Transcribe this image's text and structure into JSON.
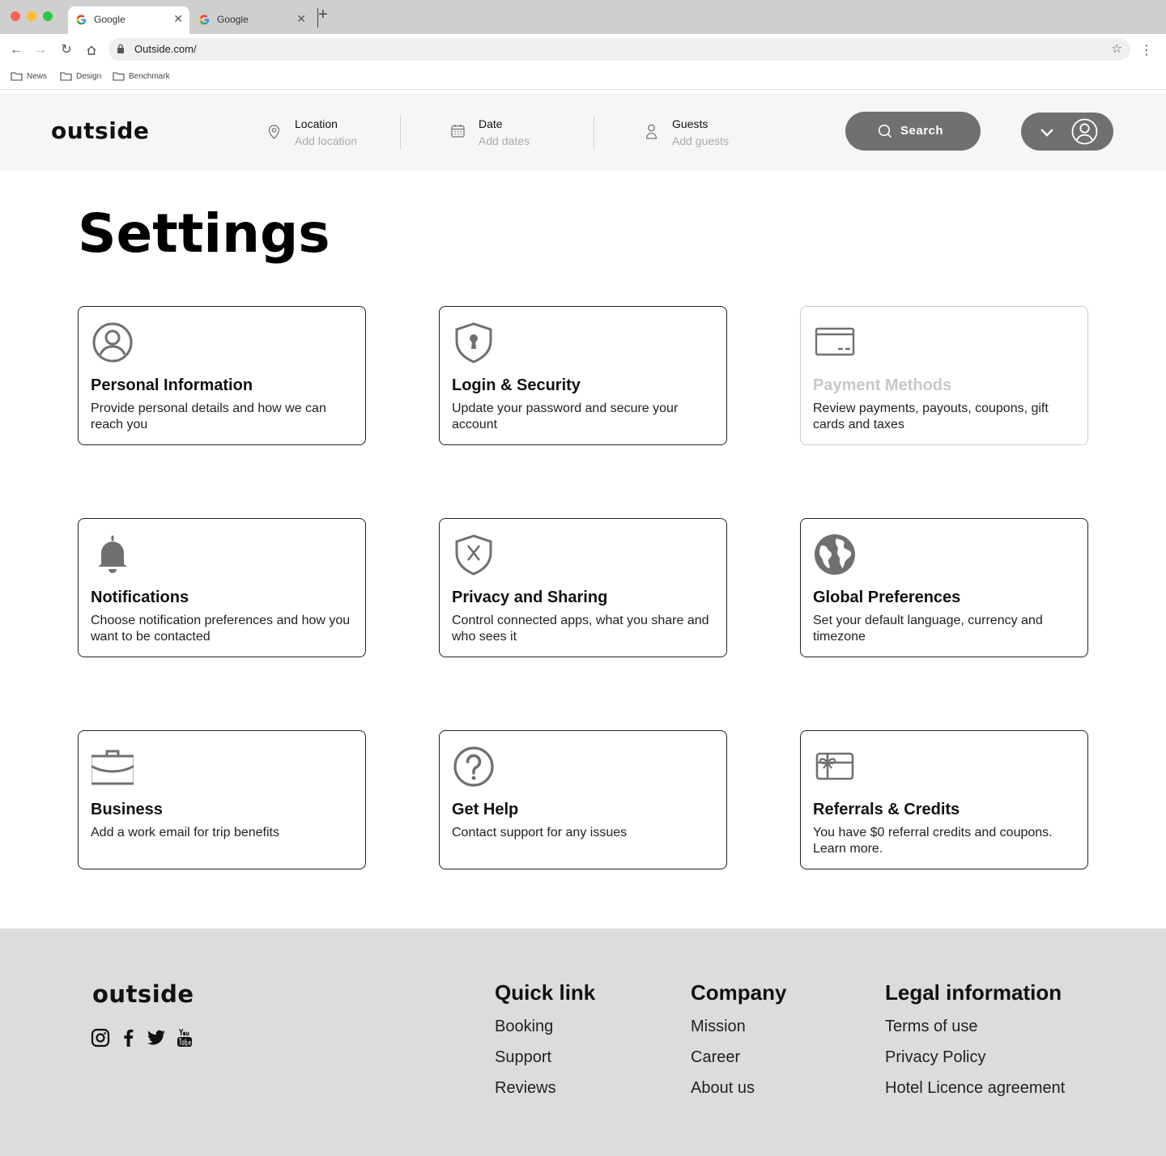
{
  "browser": {
    "tabs": [
      {
        "title": "Google",
        "active": true
      },
      {
        "title": "Google",
        "active": false
      }
    ],
    "new_tab_icon": "plus-icon",
    "url": "Outside.com/",
    "bookmarks": [
      "News",
      "Design",
      "Benchmark"
    ]
  },
  "header": {
    "logo": "outside",
    "location": {
      "label": "Location",
      "placeholder": "Add location"
    },
    "date": {
      "label": "Date",
      "placeholder": "Add dates"
    },
    "guests": {
      "label": "Guests",
      "placeholder": "Add guests"
    },
    "search_label": "Search"
  },
  "main": {
    "title": "Settings",
    "cards": [
      {
        "icon": "user-circle-icon",
        "title": "Personal Information",
        "desc": "Provide personal details and how we can reach you",
        "disabled": false
      },
      {
        "icon": "shield-keyhole-icon",
        "title": "Login & Security",
        "desc": "Update your password and secure your account",
        "disabled": false
      },
      {
        "icon": "credit-card-icon",
        "title": "Payment Methods",
        "desc": "Review payments, payouts, coupons, gift cards and taxes",
        "disabled": true
      },
      {
        "icon": "bell-icon",
        "title": "Notifications",
        "desc": "Choose notification preferences and how you want to be contacted",
        "disabled": false
      },
      {
        "icon": "shield-x-icon",
        "title": "Privacy and Sharing",
        "desc": "Control connected apps, what you share and who sees it",
        "disabled": false
      },
      {
        "icon": "globe-icon",
        "title": "Global Preferences",
        "desc": "Set your default language, currency and timezone",
        "disabled": false
      },
      {
        "icon": "briefcase-icon",
        "title": "Business",
        "desc": "Add a work email for trip benefits",
        "disabled": false
      },
      {
        "icon": "help-circle-icon",
        "title": "Get Help",
        "desc": "Contact support for any issues",
        "disabled": false
      },
      {
        "icon": "gift-card-icon",
        "title": "Referrals & Credits",
        "desc": "You have $0 referral credits and coupons. Learn more.",
        "disabled": false
      }
    ]
  },
  "footer": {
    "logo": "outside",
    "social": [
      "instagram-icon",
      "facebook-icon",
      "twitter-icon",
      "youtube-icon"
    ],
    "columns": [
      {
        "heading": "Quick link",
        "links": [
          "Booking",
          "Support",
          "Reviews"
        ]
      },
      {
        "heading": "Company",
        "links": [
          "Mission",
          "Career",
          "About us"
        ]
      },
      {
        "heading": "Legal information",
        "links": [
          "Terms of use",
          "Privacy Policy",
          "Hotel Licence agreement"
        ]
      }
    ]
  },
  "colors": {
    "chrome_bg": "#cfcfcf",
    "header_bg": "#f6f6f6",
    "button_bg": "#707070",
    "footer_bg": "#dcdcdc",
    "icon_gray": "#707070"
  }
}
